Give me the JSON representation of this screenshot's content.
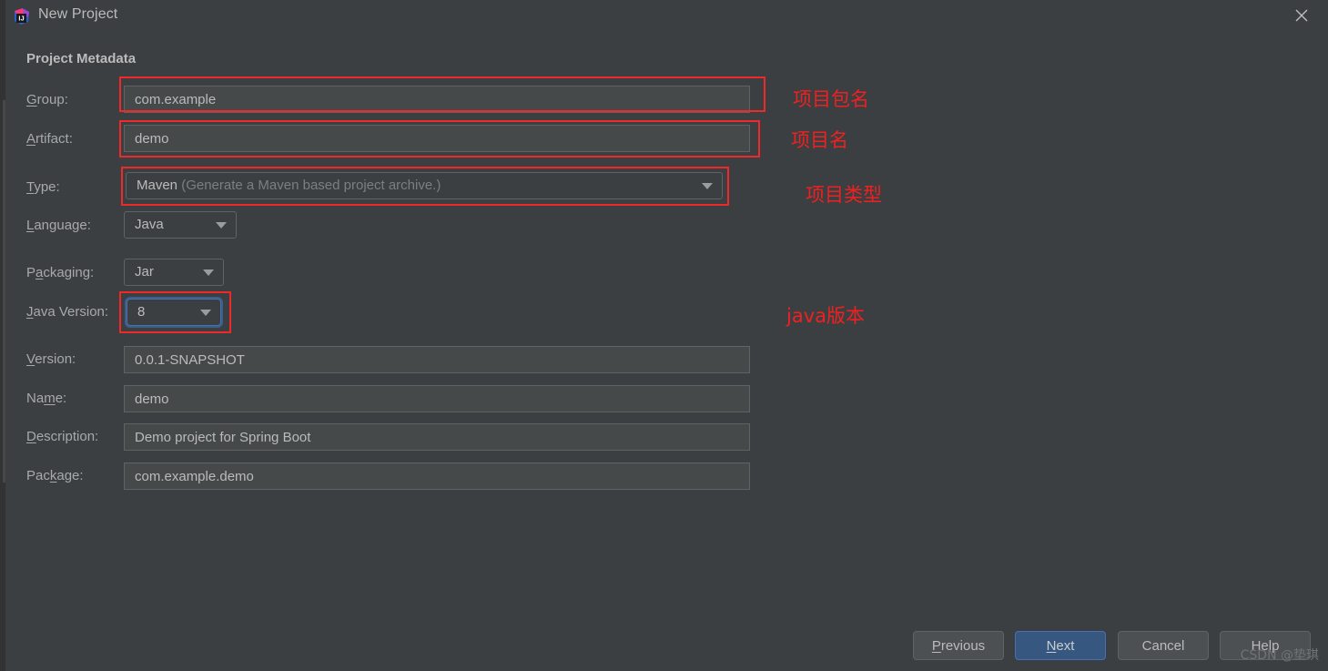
{
  "window": {
    "title": "New Project",
    "icon": "intellij-idea-logo",
    "close_label": "×"
  },
  "section": {
    "title": "Project Metadata"
  },
  "fields": {
    "group": {
      "label_prefix": "",
      "label_mnemonic": "G",
      "label_suffix": "roup:",
      "value": "com.example"
    },
    "artifact": {
      "label_prefix": "",
      "label_mnemonic": "A",
      "label_suffix": "rtifact:",
      "value": "demo"
    },
    "type": {
      "label_prefix": "",
      "label_mnemonic": "T",
      "label_suffix": "ype:",
      "value": "Maven",
      "hint": "(Generate a Maven based project archive.)"
    },
    "language": {
      "label_prefix": "",
      "label_mnemonic": "L",
      "label_suffix": "anguage:",
      "value": "Java"
    },
    "packaging": {
      "label_prefix": "P",
      "label_mnemonic": "a",
      "label_suffix": "ckaging:",
      "value": "Jar"
    },
    "java_version": {
      "label_prefix": "",
      "label_mnemonic": "J",
      "label_suffix": "ava Version:",
      "value": "8"
    },
    "version": {
      "label_prefix": "",
      "label_mnemonic": "V",
      "label_suffix": "ersion:",
      "value": "0.0.1-SNAPSHOT"
    },
    "name": {
      "label_prefix": "Na",
      "label_mnemonic": "m",
      "label_suffix": "e:",
      "value": "demo"
    },
    "description": {
      "label_prefix": "",
      "label_mnemonic": "D",
      "label_suffix": "escription:",
      "value": "Demo project for Spring Boot"
    },
    "package": {
      "label_prefix": "Pac",
      "label_mnemonic": "k",
      "label_suffix": "age:",
      "value": "com.example.demo"
    }
  },
  "annotations": {
    "group": "项目包名",
    "artifact": "项目名",
    "type": "项目类型",
    "java_version": "java版本"
  },
  "buttons": {
    "previous": {
      "prefix": "",
      "mnemonic": "P",
      "suffix": "revious"
    },
    "next": {
      "prefix": "",
      "mnemonic": "N",
      "suffix": "ext"
    },
    "cancel": {
      "prefix": "Cancel",
      "mnemonic": "",
      "suffix": ""
    },
    "help": {
      "prefix": "Help",
      "mnemonic": "",
      "suffix": ""
    }
  },
  "watermark": "CSDN @垫琪",
  "colors": {
    "background": "#3c3f41",
    "field_background": "#45494a",
    "accent_blue": "#365880",
    "annotation_red": "#ef2020",
    "focus_ring": "#3b5e8c"
  }
}
